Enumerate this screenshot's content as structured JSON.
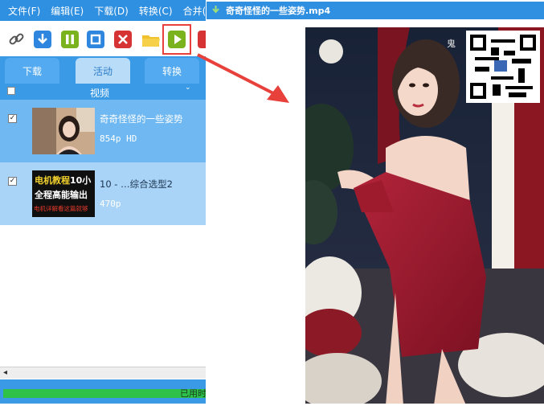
{
  "menu": {
    "items": [
      "文件(F)",
      "编辑(E)",
      "下载(D)",
      "转换(C)",
      "合并(M)"
    ]
  },
  "toolbar": {
    "buttons": [
      "link-icon",
      "download-icon",
      "pause-icon",
      "stop-icon",
      "delete-icon",
      "folder-icon",
      "play-icon",
      "red-icon"
    ]
  },
  "tabs": [
    "下载",
    "活动",
    "转换"
  ],
  "list": {
    "header": "视频",
    "rows": [
      {
        "title": "奇奇怪怪的一些姿势",
        "sub": "854p HD",
        "checked": true,
        "selected": true
      },
      {
        "title": "10 - …综合选型2",
        "sub": "470p",
        "checked": true,
        "selected": false,
        "thumb": {
          "line1a": "电机教程",
          "line1b": "10小",
          "line2": "全程高能输出",
          "line3": "电机详解看这篇就够"
        }
      }
    ]
  },
  "status": {
    "text": "已用时"
  },
  "preview": {
    "title": "奇奇怪怪的一些姿势.mp4",
    "watermark": "鬼"
  },
  "colors": {
    "accent": "#2f8fe0",
    "selected_row": "#6fb8f2",
    "second_row": "#a9d4f7",
    "progress": "#2ec24a",
    "highlight": "#e8413c"
  }
}
